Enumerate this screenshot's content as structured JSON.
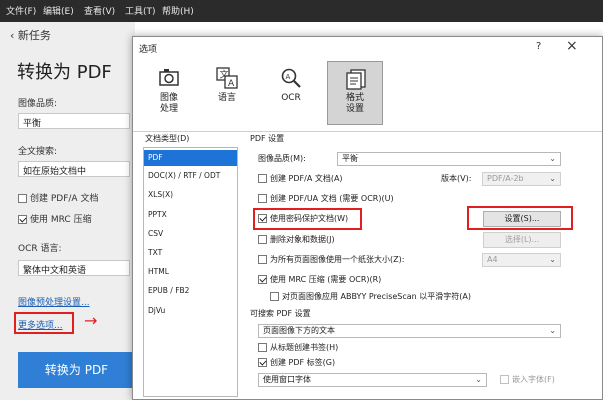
{
  "menubar": {
    "items": [
      "文件(F)",
      "编辑(E)",
      "查看(V)",
      "工具(T)",
      "帮助(H)"
    ]
  },
  "left_pane": {
    "back_label": "新任务",
    "title": "转换为 PDF",
    "image_quality_label": "图像品质:",
    "image_quality_value": "平衡",
    "fulltext_label": "全文搜索:",
    "fulltext_value": "如在原始文档中",
    "pdfa_label": "创建 PDF/A 文档",
    "mrc_label": "使用 MRC 压缩",
    "ocr_label": "OCR 语言:",
    "ocr_value": "繁体中文和英语",
    "preprocess_link": "图像预处理设置...",
    "more_options_link": "更多选项...",
    "convert_button": "转换为 PDF"
  },
  "dialog": {
    "title": "选项",
    "help_glyph": "?",
    "close_glyph": "×",
    "ribbon": [
      {
        "line1": "图像",
        "line2": "处理",
        "icon": "image-processing-icon"
      },
      {
        "line1": "语言",
        "line2": "",
        "icon": "language-icon"
      },
      {
        "line1": "OCR",
        "line2": "",
        "icon": "ocr-icon"
      },
      {
        "line1": "格式",
        "line2": "设置",
        "icon": "format-settings-icon"
      }
    ],
    "doctypes_label": "文档类型(D)",
    "doctypes": [
      "PDF",
      "DOC(X) / RTF / ODT",
      "XLS(X)",
      "PPTX",
      "CSV",
      "TXT",
      "HTML",
      "EPUB / FB2",
      "DjVu"
    ],
    "pdf_settings_label": "PDF 设置",
    "quality_label": "图像品质(M):",
    "quality_value": "平衡",
    "pdfa_label": "创建 PDF/A 文档(A)",
    "version_label": "版本(V):",
    "version_value": "PDF/A-2b",
    "pdfua_label": "创建 PDF/UA 文档 (需要 OCR)(U)",
    "password_label": "使用密码保护文档(W)",
    "settings_button": "设置(S)...",
    "delete_objects_label": "删除对象和数据(J)",
    "choose_button": "选择(L)...",
    "single_paper_label": "为所有页面图像使用一个纸张大小(Z):",
    "paper_value": "A4",
    "mrc_label": "使用 MRC 压缩 (需要 OCR)(R)",
    "abbyy_label": "对页面图像应用 ABBYY PreciseScan 以平滑字符(A)",
    "searchable_label": "可搜索 PDF 设置",
    "searchable_value": "页面图像下方的文本",
    "bookmarks_label": "从标题创建书签(H)",
    "pdf_tags_label": "创建 PDF 标签(G)",
    "font_value": "使用窗口字体",
    "embed_fonts_label": "嵌入字体(F)"
  },
  "annotation": {
    "arrow_glyph": "→"
  }
}
